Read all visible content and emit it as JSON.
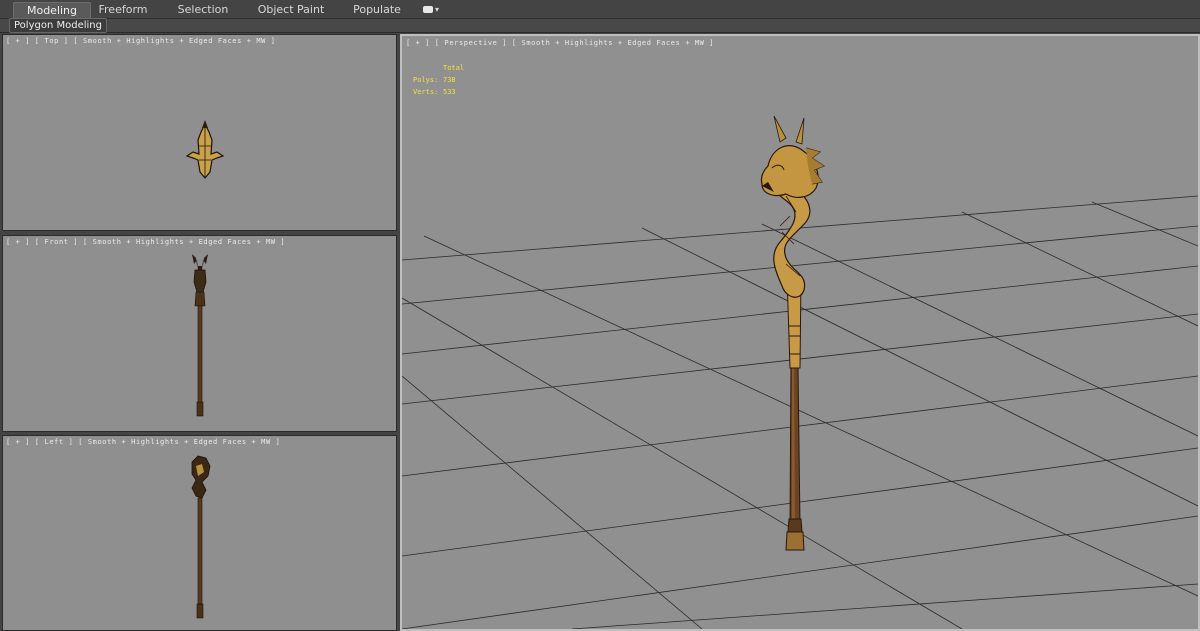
{
  "ribbon": {
    "tabs": [
      {
        "label": "Modeling",
        "active": true
      },
      {
        "label": "Freeform",
        "active": false
      },
      {
        "label": "Selection",
        "active": false
      },
      {
        "label": "Object Paint",
        "active": false
      },
      {
        "label": "Populate",
        "active": false
      }
    ],
    "panel_tab": "Polygon Modeling"
  },
  "viewports": {
    "top": {
      "label": "[ + ] [ Top ] [ Smooth + Highlights + Edged Faces + MW ]"
    },
    "front": {
      "label": "[ + ] [ Front ] [ Smooth + Highlights + Edged Faces + MW ]"
    },
    "left": {
      "label": "[ + ] [ Left ] [ Smooth + Highlights + Edged Faces + MW ]"
    },
    "perspective": {
      "label": "[ + ] [ Perspective ] [ Smooth + Highlights + Edged Faces + MW ]"
    }
  },
  "stats": {
    "header": "Total",
    "polys_label": "Polys:",
    "polys_value": "738",
    "verts_label": "Verts:",
    "verts_value": "533",
    "color": "#f1e23b"
  },
  "colors": {
    "viewport_bg": "#8f8f8f",
    "grid": "#2a2a2a",
    "gold": "#c9a14a",
    "staff_dark": "#5a3a1e"
  }
}
